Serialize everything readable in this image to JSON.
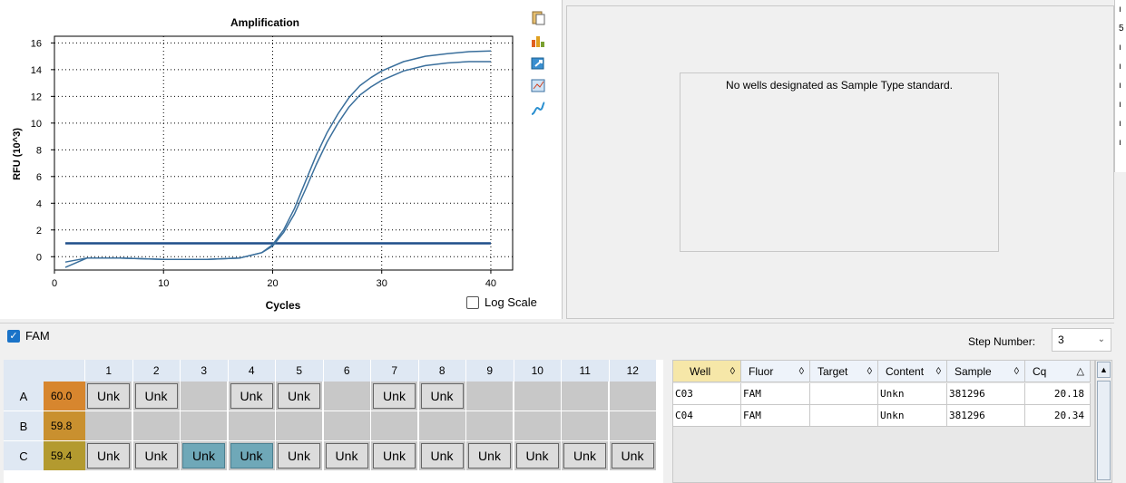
{
  "chart": {
    "title": "Amplification",
    "xlabel": "Cycles",
    "ylabel": "RFU (10^3)",
    "log_scale_label": "Log Scale"
  },
  "chart_data": {
    "type": "line",
    "title": "Amplification",
    "xlabel": "Cycles",
    "ylabel": "RFU (10^3)",
    "xlim": [
      0,
      42
    ],
    "ylim": [
      -1,
      16.5
    ],
    "xticks": [
      0,
      10,
      20,
      30,
      40
    ],
    "yticks": [
      0,
      2,
      4,
      6,
      8,
      10,
      12,
      14,
      16
    ],
    "grid": true,
    "threshold": 1.0,
    "series": [
      {
        "x": [
          1,
          3,
          6,
          10,
          14,
          17,
          19,
          20,
          21,
          22,
          23,
          24,
          25,
          26,
          27,
          28,
          29,
          30,
          32,
          34,
          36,
          38,
          40
        ],
        "y": [
          -0.4,
          -0.1,
          -0.1,
          -0.2,
          -0.2,
          -0.1,
          0.3,
          0.9,
          2.0,
          3.6,
          5.6,
          7.6,
          9.3,
          10.7,
          11.9,
          12.8,
          13.4,
          13.9,
          14.6,
          15.0,
          15.2,
          15.35,
          15.4
        ],
        "color": "#3a6f9c"
      },
      {
        "x": [
          1,
          3,
          6,
          10,
          14,
          17,
          19,
          20,
          21,
          22,
          23,
          24,
          25,
          26,
          27,
          28,
          29,
          30,
          32,
          34,
          36,
          38,
          40
        ],
        "y": [
          -0.8,
          -0.1,
          -0.1,
          -0.2,
          -0.2,
          -0.1,
          0.3,
          0.8,
          1.8,
          3.2,
          5.0,
          6.9,
          8.6,
          10.0,
          11.2,
          12.1,
          12.7,
          13.2,
          13.9,
          14.3,
          14.5,
          14.6,
          14.6
        ],
        "color": "#3a6f9c"
      }
    ]
  },
  "standard_curve": {
    "message": "No wells designated as Sample Type standard."
  },
  "edge_strip_chars": [
    "ı",
    "5",
    "ı",
    "ı",
    "ı",
    "ı",
    "ı",
    "ı"
  ],
  "fluor": {
    "label": "FAM",
    "checked": true
  },
  "step": {
    "label": "Step Number:",
    "value": "3"
  },
  "plate": {
    "columns": [
      "1",
      "2",
      "3",
      "4",
      "5",
      "6",
      "7",
      "8",
      "9",
      "10",
      "11",
      "12"
    ],
    "rows": [
      {
        "label": "A",
        "temp": "60.0",
        "temp_color": "#d7862e",
        "wells": [
          "Unk",
          "Unk",
          "",
          "Unk",
          "Unk",
          "",
          "Unk",
          "Unk",
          "",
          "",
          "",
          ""
        ]
      },
      {
        "label": "B",
        "temp": "59.8",
        "temp_color": "#c9902f",
        "wells": [
          "",
          "",
          "",
          "",
          "",
          "",
          "",
          "",
          "",
          "",
          "",
          ""
        ]
      },
      {
        "label": "C",
        "temp": "59.4",
        "temp_color": "#b39a2f",
        "wells": [
          "Unk",
          "Unk",
          "Unk",
          "Unk",
          "Unk",
          "Unk",
          "Unk",
          "Unk",
          "Unk",
          "Unk",
          "Unk",
          "Unk"
        ],
        "selected": [
          2,
          3
        ]
      }
    ]
  },
  "results": {
    "headers": [
      "Well",
      "Fluor",
      "Target",
      "Content",
      "Sample",
      "Cq"
    ],
    "rows": [
      [
        "C03",
        "FAM",
        "",
        "Unkn",
        "381296",
        "20.18"
      ],
      [
        "C04",
        "FAM",
        "",
        "Unkn",
        "381296",
        "20.34"
      ]
    ]
  }
}
